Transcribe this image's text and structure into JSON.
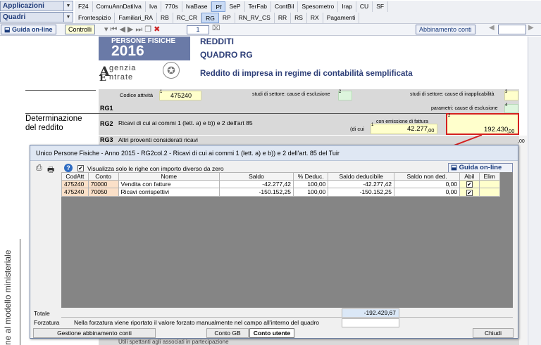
{
  "menu": {
    "row1_combo": "Applicazioni",
    "row2_combo": "Quadri",
    "row1_items": [
      "F24",
      "ComuAnnDatiIva",
      "Iva",
      "770s",
      "IvaBase",
      "Pf",
      "SeP",
      "TerFab",
      "ContBil",
      "Spesometro",
      "Irap",
      "CU",
      "SF"
    ],
    "row1_selected": "Pf",
    "row2_items": [
      "Frontespizio",
      "Familiari_RA",
      "RB",
      "RC_CR",
      "RG",
      "RP",
      "RN_RV_CS",
      "RR",
      "RS",
      "RX",
      "Pagamenti"
    ],
    "row2_selected": "RG"
  },
  "toolbar": {
    "guida_label": "Guida on-line",
    "controlli_label": "Controlli",
    "page_number": "1",
    "abbinamento_label": "Abbinamento conti"
  },
  "document": {
    "logo_line1": "PERSONE FISICHE",
    "logo_line2": "2016",
    "agency_line1": "genzia",
    "agency_line2": "ntrate",
    "title1": "REDDITI",
    "title2": "QUADRO RG",
    "subtitle": "Reddito di impresa in regime di contabilità semplificata",
    "codice_attivita_label": "Codice attività",
    "codice_attivita_index": "1",
    "codice_attivita_value": "475240",
    "studi_esclusione_label": "studi di settore: cause di esclusione",
    "studi_esclusione_index": "2",
    "studi_inapplicabilita_label": "studi di settore: cause di inapplicabilità",
    "studi_inapplicabilita_index": "3",
    "parametri_label": "parametri: cause di esclusione",
    "parametri_index": "4",
    "rg1": "RG1",
    "section_label_1": "Determinazione",
    "section_label_2": "del reddito",
    "rg2": "RG2",
    "rg2_text": "Ricavi di cui ai commi 1 (lett. a) e b)) e 2 dell'art 85",
    "di_cui_label": "(di cui",
    "emissione_label": "con emissione di fattura",
    "rg2_col1_index": "1",
    "rg2_col1_value": "42.277",
    "rg2_col1_dec": ",00",
    "rg2_col2_index": "2",
    "rg2_col2_value": "192.430",
    "rg2_col2_dec": ",00",
    "rg3": "RG3",
    "rg3_text": "Altri proventi considerati ricavi",
    "rg_bottom_text": "Utili spettanti agli associati in partecipazione",
    "side_vertical_text": "ne al modello ministeriale",
    "right_dec": ",00"
  },
  "dialog": {
    "title": "Unico Persone Fisiche - Anno 2015 - RG2col.2 - Ricavi di cui ai commi 1 (lett. a) e b)) e 2 dell'art. 85 del Tuir",
    "filter_label": "Visualizza solo le righe con importo diverso da zero",
    "filter_checked": true,
    "guida_label": "Guida on-line",
    "columns": [
      "CodAtt",
      "Conto",
      "Nome",
      "Saldo",
      "% Deduc.",
      "Saldo deducibile",
      "Saldo non ded.",
      "Abil",
      "Elim"
    ],
    "rows": [
      {
        "codatt": "475240",
        "conto": "70000",
        "nome": "Vendita con fatture",
        "saldo": "-42.277,42",
        "deduc": "100,00",
        "saldo_ded": "-42.277,42",
        "saldo_non_ded": "0,00",
        "abil": true
      },
      {
        "codatt": "475240",
        "conto": "70050",
        "nome": "Ricavi corrispettivi",
        "saldo": "-150.152,25",
        "deduc": "100,00",
        "saldo_ded": "-150.152,25",
        "saldo_non_ded": "0,00",
        "abil": true
      }
    ],
    "totale_label": "Totale",
    "totale_value": "-192.429,67",
    "forzatura_label": "Forzatura",
    "forzatura_note": "Nella forzatura viene riportato il valore forzato manualmente nel campo all'interno del quadro",
    "gestione_label": "Gestione abbinamento conti",
    "conto_gb_label": "Conto GB",
    "conto_utente_label": "Conto utente",
    "chiudi_label": "Chiudi"
  },
  "colors": {
    "accent_red": "#d42020",
    "field_yellow": "#ffffcc",
    "grid_bg": "#858585",
    "cod_orange": "#fbe0c8"
  }
}
